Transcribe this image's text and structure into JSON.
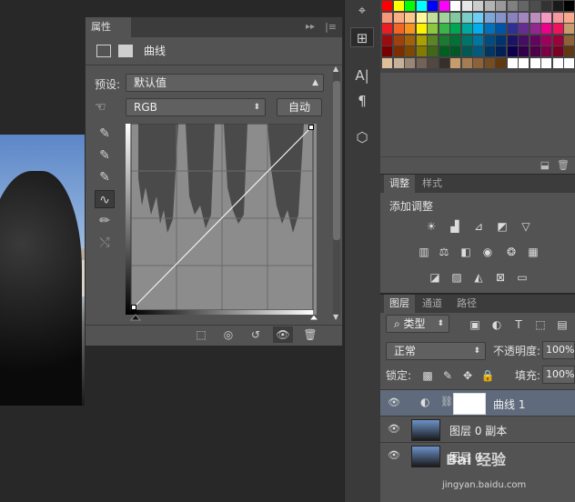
{
  "properties_panel": {
    "tab_label": "属性",
    "title": "曲线",
    "preset_label": "预设:",
    "preset_value": "默认值",
    "channel_value": "RGB",
    "auto_button": "自动"
  },
  "adjustments_panel": {
    "tabs": [
      "调整",
      "样式"
    ],
    "add_adjustment_label": "添加调整"
  },
  "layers_panel": {
    "tabs": [
      "图层",
      "通道",
      "路径"
    ],
    "kind_filter": "类型",
    "blend_mode": "正常",
    "opacity_label": "不透明度:",
    "opacity_value": "100%",
    "lock_label": "锁定:",
    "fill_label": "填充:",
    "fill_value": "100%",
    "layers": [
      {
        "name": "曲线 1",
        "selected": true
      },
      {
        "name": "图层 0 副本",
        "selected": false
      },
      {
        "name": "图层 0",
        "selected": false
      }
    ]
  },
  "watermark": {
    "brand": "Bai 经验",
    "url": "jingyan.baidu.com"
  },
  "colors": {
    "panel_bg": "#535353",
    "selected_layer": "#5f6b7c",
    "app_bg": "#282828"
  },
  "icons": [
    "curves-icon",
    "mask-icon",
    "hand-adjust-icon",
    "eyedropper-icon",
    "curve-tool-icon",
    "pencil-icon",
    "smooth-icon",
    "eye-icon",
    "trash-icon"
  ]
}
